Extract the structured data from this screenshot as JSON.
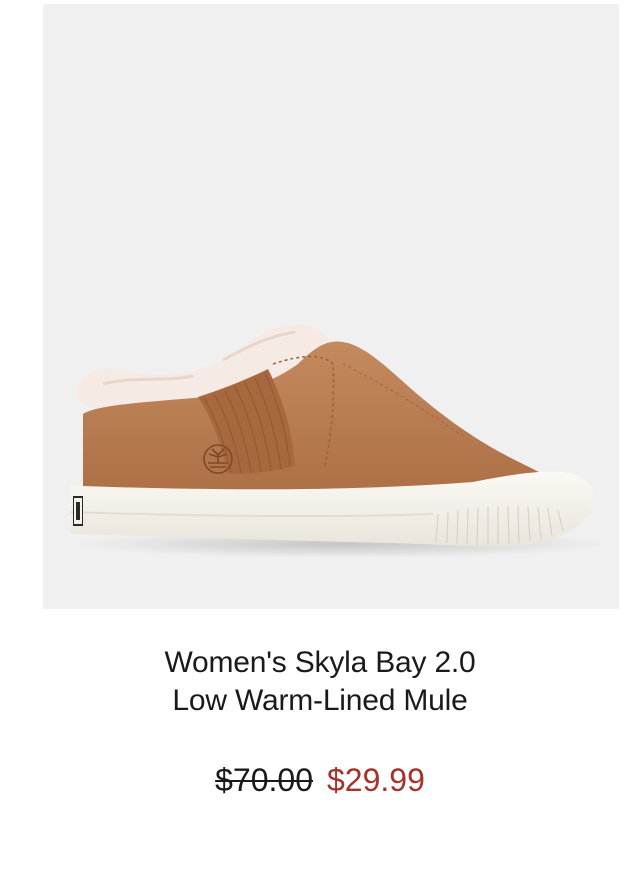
{
  "product": {
    "title_line1": "Women's Skyla Bay 2.0",
    "title_line2": "Low Warm-Lined Mule",
    "price_original": "$70.00",
    "price_sale": "$29.99",
    "image_icon": "shoe-image"
  },
  "colors": {
    "image_background": "#f0f0f0",
    "sale_price": "#a5322b",
    "text": "#1a1a1a",
    "suede": "#b8794f",
    "sole": "#f5f2ec",
    "fleece": "#f4e9e2"
  }
}
